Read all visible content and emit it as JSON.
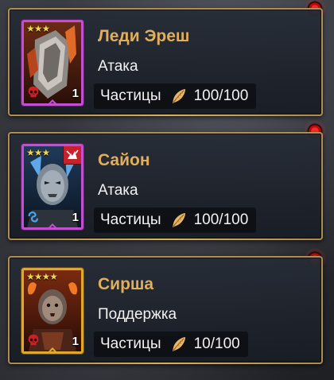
{
  "heroes": [
    {
      "name": "Леди Эреш",
      "role": "Атака",
      "particles_label": "Частицы",
      "particles_value": "100/100",
      "stars": "★★★",
      "level": "1",
      "rarity": "epic",
      "frame_color": "#c24fd2",
      "faction_icon": "red-skull-icon"
    },
    {
      "name": "Сайон",
      "role": "Атака",
      "particles_label": "Частицы",
      "particles_value": "100/100",
      "stars": "★★★",
      "level": "1",
      "rarity": "epic",
      "frame_color": "#c24fd2",
      "faction_icon": "blue-wave-icon",
      "affinity_icon": "red-force-affinity-icon"
    },
    {
      "name": "Сирша",
      "role": "Поддержка",
      "particles_label": "Частицы",
      "particles_value": "10/100",
      "stars": "★★★★",
      "level": "1",
      "rarity": "legendary",
      "frame_color": "#e0a82a",
      "faction_icon": "red-skull-icon"
    }
  ],
  "colors": {
    "name_gold": "#e2ae5a",
    "card_border": "#b08d4e",
    "notification_red": "#ff2b2b"
  }
}
